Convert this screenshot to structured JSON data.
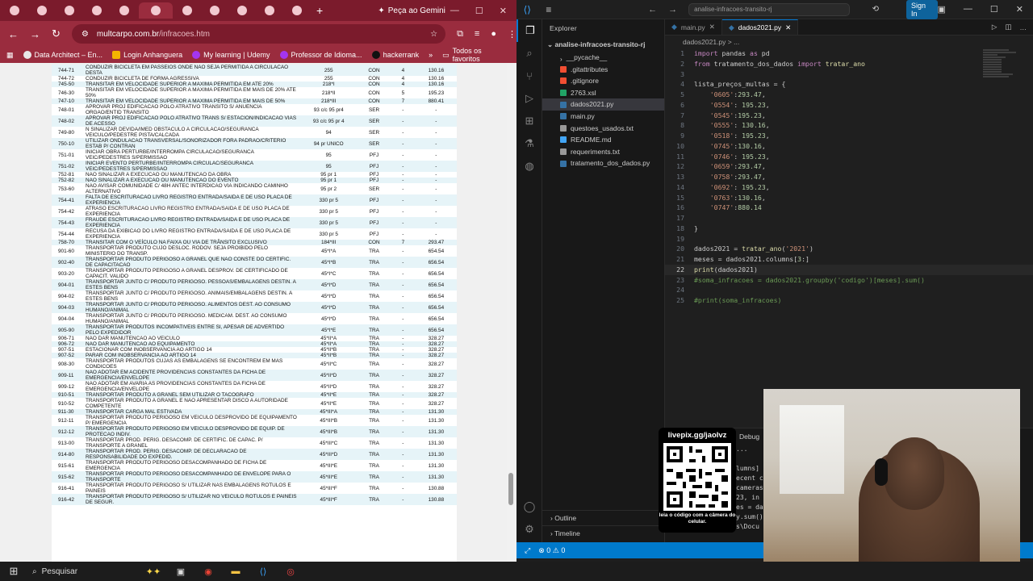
{
  "chrome": {
    "tabs": [
      "",
      "",
      "",
      "",
      "",
      "",
      "",
      "",
      "",
      "",
      ""
    ],
    "new_tab_label": "+",
    "gemini_label": "Peça ao Gemini",
    "url_domain": "multcarpo.com.br",
    "url_path": "/infracoes.htm",
    "bookmarks": [
      "Data Architect – En...",
      "Login Anhanguera",
      "My learning | Udemy",
      "Professor de Idioma...",
      "hackerrank"
    ],
    "all_bookmarks": "Todos os favoritos"
  },
  "infractions": [
    [
      "744-71",
      "CONDUZIR BICICLETA EM PASSEIOS ONDE NAO SEJA PERMITIDA A CIRCULACAO DESTA",
      "255",
      "CON",
      "4",
      "130.16"
    ],
    [
      "744-72",
      "CONDUZIR BICICLETA DE FORMA AGRESSIVA",
      "255",
      "CON",
      "4",
      "130.16"
    ],
    [
      "745-50",
      "TRANSITAR EM VELOCIDADE SUPERIOR A MAXIMA PERMITIDA EM ATE 20%",
      "218*I",
      "CON",
      "4",
      "130.16"
    ],
    [
      "746-30",
      "TRANSITAR EM VELOCIDADE SUPERIOR A MAXIMA PERMITIDA EM MAIS DE 20% ATE 50%",
      "218*II",
      "CON",
      "5",
      "195.23"
    ],
    [
      "747-10",
      "TRANSITAR EM VELOCIDADE SUPERIOR A MAXIMA PERMITIDA EM MAIS DE 50%",
      "218*III",
      "CON",
      "7",
      "880.41"
    ],
    [
      "748-01",
      "APROVAR PROJ EDIFICACAO POLO ATRATIVO TRANSITO S/ ANUENCIA ORGAO/ENTID TRANSITO",
      "93 c/c 95 pr4",
      "SER",
      "-",
      "-"
    ],
    [
      "748-02",
      "APROVAR PROJ EDIFICACAO POLO ATRATIVO TRANS S/ ESTACION/INDICACAO VIAS DE ACESSO",
      "93 c/c 95 pr 4",
      "SER",
      "-",
      "-"
    ],
    [
      "749-80",
      "N SINALIZAR DEVIDA/IMED OBSTACULO A CIRCULACAO/SEGURANCA VEICULO/PEDESTRE PISTA/CALCADA",
      "94",
      "SER",
      "-",
      "-"
    ],
    [
      "750-10",
      "UTILIZAR ONDULACAO TRANSVERSAL/SONORIZADOR FORA PADRAO/CRITERIO ESTAB P/ CONTRAN",
      "94 pr UNICO",
      "SER",
      "-",
      "-"
    ],
    [
      "751-01",
      "INICIAR OBRA PERTURBE/INTERROMPA CIRCULACAO/SEGURANCA VEIC/PEDESTRES S/PERMISSAO",
      "95",
      "PFJ",
      "-",
      "-"
    ],
    [
      "751-02",
      "INICIAR EVENTO PERTURBE/INTERROMPA CIRCULAC/SEGURANCA VEIC/PEDESTRES S/PERMISSAO",
      "95",
      "PFJ",
      "-",
      "-"
    ],
    [
      "752-81",
      "NAO SINALIZAR A EXECUCAO OU MANUTENCAO DA OBRA",
      "95 pr 1",
      "PFJ",
      "-",
      "-"
    ],
    [
      "752-82",
      "NAO SINALIZAR A EXECUCAO OU MANUTENCAO DO EVENTO",
      "95 pr 1",
      "PFJ",
      "-",
      "-"
    ],
    [
      "753-60",
      "NAO AVISAR COMUNIDADE C/ 48H ANTEC INTERDICAO VIA INDICANDO CAMINHO ALTERNATIVO",
      "95 pr 2",
      "SER",
      "-",
      "-"
    ],
    [
      "754-41",
      "FALTA DE ESCRITURACAO LIVRO REGISTRO ENTRADA/SAIDA E DE USO PLACA DE EXPERIENCIA",
      "330 pr 5",
      "PFJ",
      "-",
      "-"
    ],
    [
      "754-42",
      "ATRASO ESCRITURACAO LIVRO REGISTRO ENTRADA/SAIDA E DE USO PLACA DE EXPERIENCIA",
      "330 pr 5",
      "PFJ",
      "-",
      "-"
    ],
    [
      "754-43",
      "FRAUDE ESCRITURACAO LIVRO REGISTRO ENTRADA/SAIDA E DE USO PLACA DE EXPERIENCIA",
      "330 pr 5",
      "PFJ",
      "-",
      "-"
    ],
    [
      "754-44",
      "RECUSA DA EXIBICAO DO LIVRO REGISTRO ENTRADA/SAIDA E DE USO PLACA DE EXPERIENCIA",
      "330 pr 5",
      "PFJ",
      "-",
      "-"
    ],
    [
      "758-70",
      "TRANSITAR COM O VEÍCULO NA FAIXA OU VIA DE TRÂNSITO EXCLUSIVO",
      "184*III",
      "CON",
      "7",
      "293.47"
    ],
    [
      "901-60",
      "TRANSPORTAR PRODUTO CUJO DESLOC. RODOV. SEJA PROIBIDO PELO MINISTERIO DO TRANSP.",
      "45*I*A",
      "TRA",
      "-",
      "654.54"
    ],
    [
      "902-40",
      "TRANSPORTAR PRODUTO PERIGOSO A GRANEL QUE NAO CONSTE DO CERTIFIC. DE CAPACITACAO",
      "45*I*B",
      "TRA",
      "-",
      "656.54"
    ],
    [
      "903-20",
      "TRANSPORTAR PRODUTO PERIGOSO A GRANEL DESPROV. DE CERTIFICADO DE CAPACIT. VALIDO",
      "45*I*C",
      "TRA",
      "-",
      "656.54"
    ],
    [
      "904-01",
      "TRANSPORTAR JUNTO C/ PRODUTO PERIGOSO. PESSOAS/EMBALAGENS DESTIN. A ESTES BENS",
      "45*I*D",
      "TRA",
      "-",
      "656.54"
    ],
    [
      "904-02",
      "TRANSPORTAR JUNTO C/ PRODUTO PERIGOSO. ANIMAIS/EMBALAGENS DESTIN. A ESTES BENS",
      "45*I*D",
      "TRA",
      "-",
      "656.54"
    ],
    [
      "904-03",
      "TRANSPORTAR JUNTO C/ PRODUTO PERIGOSO. ALIMENTOS DEST. AO CONSUMO HUMANO/ANIMAL",
      "45*I*D",
      "TRA",
      "-",
      "656.54"
    ],
    [
      "904-04",
      "TRANSPORTAR JUNTO C/ PRODUTO PERIGOSO. MEDICAM. DEST. AO CONSUMO HUMANO/ANIMAL",
      "45*I*D",
      "TRA",
      "-",
      "656.54"
    ],
    [
      "905-90",
      "TRANSPORTAR PRODUTOS INCOMPATIVEIS ENTRE SI, APESAR DE ADVERTIDO PELO EXPEDIDOR",
      "45*I*E",
      "TRA",
      "-",
      "656.54"
    ],
    [
      "906-71",
      "NAO DAR MANUTENCAO AO VEICULO",
      "45*II*A",
      "TRA",
      "-",
      "328.27"
    ],
    [
      "906-72",
      "NAO DAR MANUTENCAO AO EQUIPAMENTO",
      "45*II*A",
      "TRA",
      "-",
      "328.27"
    ],
    [
      "907-51",
      "ESTACIONAR COM INOBSERVANCIA AO ARTIGO 14",
      "45*II*B",
      "TRA",
      "-",
      "328.27"
    ],
    [
      "907-52",
      "PARAR COM INOBSERVANCIA AO ARTIGO 14",
      "45*II*B",
      "TRA",
      "-",
      "328.27"
    ],
    [
      "908-30",
      "TRANSPORTAR PRODUTOS CUJAS AS EMBALAGENS SE ENCONTREM EM MAS CONDICOES",
      "45*II*C",
      "TRA",
      "-",
      "328.27"
    ],
    [
      "909-11",
      "NAO ADOTAR EM ACIDENTE PROVIDENCIAS CONSTANTES DA FICHA DE EMERGENCIA/ENVELOPE",
      "45*II*D",
      "TRA",
      "-",
      "328.27"
    ],
    [
      "909-12",
      "NAO ADOTAR EM AVARIA AS PROVIDENCIAS CONSTANTES DA FICHA DE EMERGENCIA/ENVELOPE",
      "45*II*D",
      "TRA",
      "-",
      "328.27"
    ],
    [
      "910-51",
      "TRANSPORTAR PRODUTO A GRANEL SEM UTILIZAR O TACOGRAFO",
      "45*II*E",
      "TRA",
      "-",
      "328.27"
    ],
    [
      "910-52",
      "TRANSPORTAR PRODUTO A GRANEL E NAO APRESENTAR DISCO A AUTORIDADE COMPETENTE",
      "45*II*E",
      "TRA",
      "-",
      "328.27"
    ],
    [
      "911-30",
      "TRANSPORTAR CARGA MAL ESTIVADA",
      "45*III*A",
      "TRA",
      "-",
      "131.30"
    ],
    [
      "912-11",
      "TRANSPORTAR PRODUTO PERIGOSO EM VEICULO DESPROVIDO DE EQUIPAMENTO P/ EMERGENCIA",
      "45*III*B",
      "TRA",
      "-",
      "131.30"
    ],
    [
      "912-12",
      "TRANSPORTAR PRODUTO PERIGOSO EM VEICULO DESPROVIDO DE EQUIP. DE PROTECAO INDIV.",
      "45*III*B",
      "TRA",
      "-",
      "131.30"
    ],
    [
      "913-00",
      "TRANSPORTAR PROD. PERIG. DESACOMP. DE CERTIFIC. DE CAPAC. P/ TRANSPORTE A GRANEL",
      "45*III*C",
      "TRA",
      "-",
      "131.30"
    ],
    [
      "914-80",
      "TRANSPORTAR PROD. PERIG. DESACOMP. DE DECLARACAO DE RESPONSABILIDADE DO EXPEDID.",
      "45*III*D",
      "TRA",
      "-",
      "131.30"
    ],
    [
      "915-61",
      "TRANSPORTAR PRODUTO PERIGOSO DESACOMPANHADO DE FICHA DE EMERGENCIA",
      "45*III*E",
      "TRA",
      "-",
      "131.30"
    ],
    [
      "915-62",
      "TRANSPORTAR PRODUTO PERIGOSO DESACOMPANHADO DE ENVELOPE PARA O TRANSPORTE",
      "45*III*E",
      "TRA",
      "-",
      "131.30"
    ],
    [
      "916-41",
      "TRANSPORTAR PRODUTO PERIGOSO S/ UTILIZAR NAS EMBALAGENS ROTULOS E PAINEIS",
      "45*III*F",
      "TRA",
      "-",
      "130.88"
    ],
    [
      "916-42",
      "TRANSPORTAR PRODUTO PERIGOSO S/ UTILIZAR NO VEICULO ROTULOS E PAINEIS DE SEGUR.",
      "45*III*F",
      "TRA",
      "-",
      "130.88"
    ]
  ],
  "vscode": {
    "search_text": "analise-infracoes-transito-rj",
    "sign_in": "Sign In",
    "explorer_title": "Explorer",
    "project_name": "analise-infracoes-transito-rj",
    "files": [
      "__pycache__",
      ".gitattributes",
      ".gitignore",
      "2763.xsl",
      "dados2021.py",
      "main.py",
      "questoes_usados.txt",
      "README.md",
      "requeriments.txt",
      "tratamento_dos_dados.py"
    ],
    "outline": "Outline",
    "timeline": "Timeline",
    "tabs": [
      "main.py",
      "dados2021.py"
    ],
    "breadcrumb": "dados2021.py  >  ...",
    "debug_tab": "Debug",
    "status_errors": "0",
    "status_warnings": "0"
  },
  "code": [
    [
      "1",
      "import pandas as pd"
    ],
    [
      "2",
      "from tratamento_dos_dados import tratar_ano"
    ],
    [
      "3",
      ""
    ],
    [
      "4",
      "lista_preços_multas = {"
    ],
    [
      "5",
      "    '0605':293.47,"
    ],
    [
      "6",
      "    '0554': 195.23,"
    ],
    [
      "7",
      "    '0545':195.23,"
    ],
    [
      "8",
      "    '0555': 130.16,"
    ],
    [
      "9",
      "    '0518': 195.23,"
    ],
    [
      "10",
      "    '0745':130.16,"
    ],
    [
      "11",
      "    '0746': 195.23,"
    ],
    [
      "12",
      "    '0659':293.47,"
    ],
    [
      "13",
      "    '0758':293.47,"
    ],
    [
      "14",
      "    '0692': 195.23,"
    ],
    [
      "15",
      "    '0763':130.16,"
    ],
    [
      "16",
      "    '0747':880.14"
    ],
    [
      "17",
      ""
    ],
    [
      "18",
      "}"
    ],
    [
      "19",
      ""
    ],
    [
      "20",
      "dados2021 = tratar_ano('2021')"
    ],
    [
      "21",
      "meses = dados2021.columns[3:]"
    ],
    [
      "22",
      "print(dados2021)"
    ],
    [
      "23",
      "#soma_infracoes = dados2021.groupby('codigo')[meses].sum()"
    ],
    [
      "24",
      ""
    ],
    [
      "25",
      "#print(soma_infracoes)"
    ]
  ],
  "terminal_lines": [
    "...",
    "",
    "lumns]",
    "ecent c",
    "cameras",
    "23, in",
    "es = da",
    "y.sum()",
    "s\\Docu"
  ],
  "qr": {
    "title": "livepix.gg/jaolvz",
    "caption": "leia o código com a câmera do celular."
  },
  "taskbar": {
    "search": "Pesquisar"
  }
}
